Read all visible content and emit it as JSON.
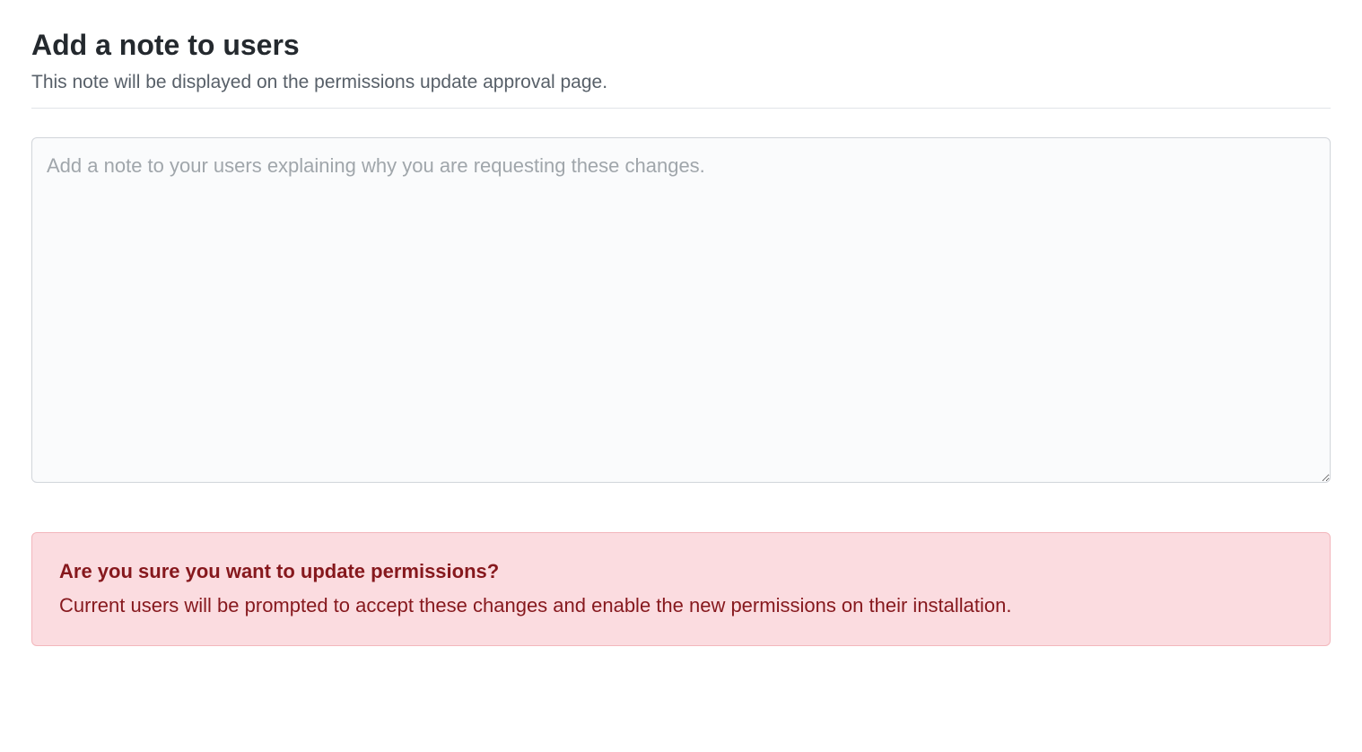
{
  "header": {
    "title": "Add a note to users",
    "subtitle": "This note will be displayed on the permissions update approval page."
  },
  "form": {
    "note_placeholder": "Add a note to your users explaining why you are requesting these changes.",
    "note_value": ""
  },
  "warning": {
    "title": "Are you sure you want to update permissions?",
    "body": "Current users will be prompted to accept these changes and enable the new permissions on their installation."
  }
}
